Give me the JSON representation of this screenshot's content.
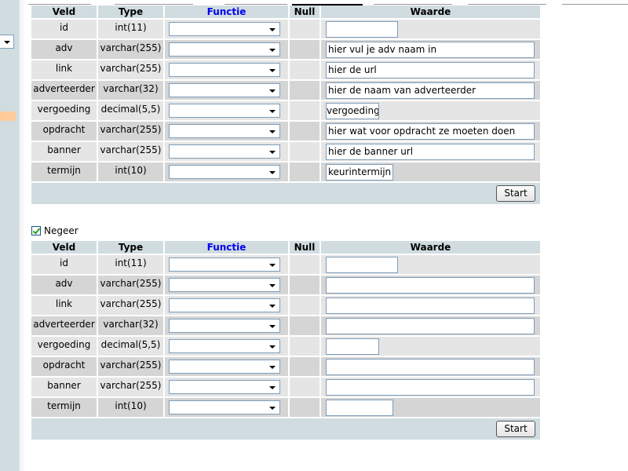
{
  "headers": {
    "veld": "Veld",
    "type": "Type",
    "functie": "Functie",
    "null": "Null",
    "waarde": "Waarde"
  },
  "form1": {
    "rows": [
      {
        "veld": "id",
        "type": "int(11)",
        "value": ""
      },
      {
        "veld": "adv",
        "type": "varchar(255)",
        "value": "hier vul je adv naam in"
      },
      {
        "veld": "link",
        "type": "varchar(255)",
        "value": "hier de url"
      },
      {
        "veld": "adverteerder",
        "type": "varchar(32)",
        "value": "hier de naam van adverteerder"
      },
      {
        "veld": "vergoeding",
        "type": "decimal(5,5)",
        "value": "vergoeding"
      },
      {
        "veld": "opdracht",
        "type": "varchar(255)",
        "value": "hier wat voor opdracht ze moeten doen"
      },
      {
        "veld": "banner",
        "type": "varchar(255)",
        "value": "hier de banner url"
      },
      {
        "veld": "termijn",
        "type": "int(10)",
        "value": "keurintermijn"
      }
    ],
    "submit_label": "Start"
  },
  "ignore_label": "Negeer",
  "form2": {
    "rows": [
      {
        "veld": "id",
        "type": "int(11)",
        "value": ""
      },
      {
        "veld": "adv",
        "type": "varchar(255)",
        "value": ""
      },
      {
        "veld": "link",
        "type": "varchar(255)",
        "value": ""
      },
      {
        "veld": "adverteerder",
        "type": "varchar(32)",
        "value": ""
      },
      {
        "veld": "vergoeding",
        "type": "decimal(5,5)",
        "value": ""
      },
      {
        "veld": "opdracht",
        "type": "varchar(255)",
        "value": ""
      },
      {
        "veld": "banner",
        "type": "varchar(255)",
        "value": ""
      },
      {
        "veld": "termijn",
        "type": "int(10)",
        "value": ""
      }
    ],
    "submit_label": "Start"
  },
  "colors": {
    "header_bg": "#d0dce0",
    "row_light": "#e5e5e5",
    "row_dark": "#d5d5d5",
    "link_blue": "#0000ee"
  }
}
